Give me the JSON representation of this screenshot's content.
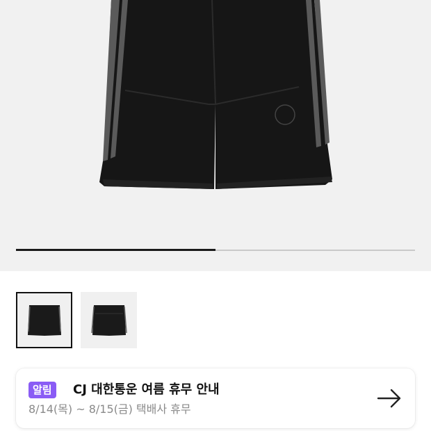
{
  "product": {
    "image_alt": "black shorts",
    "gallery_progress": 0.5
  },
  "thumbnails": [
    {
      "name": "thumbnail-front",
      "selected": true
    },
    {
      "name": "thumbnail-back",
      "selected": false
    }
  ],
  "notice": {
    "badge": "알림",
    "title": "CJ 대한통운 여름 휴무 안내",
    "subtitle": "8/14(목) ~ 8/15(금) 택배사 휴무",
    "arrow_icon": "arrow-right-icon"
  },
  "colors": {
    "badge": "#8a5cf5",
    "hero_bg": "#f1f1f1",
    "progress": "#1a1a1a"
  }
}
